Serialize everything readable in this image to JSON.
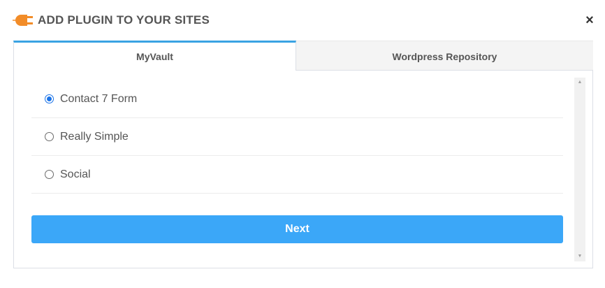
{
  "header": {
    "title": "ADD PLUGIN TO YOUR SITES",
    "close_symbol": "×",
    "icon": "plug-icon",
    "accent_color": "#f28c28"
  },
  "tabs": [
    {
      "label": "MyVault",
      "active": true
    },
    {
      "label": "Wordpress Repository",
      "active": false
    }
  ],
  "options": [
    {
      "label": "Contact 7 Form",
      "selected": true
    },
    {
      "label": "Really Simple",
      "selected": false
    },
    {
      "label": "Social",
      "selected": false
    }
  ],
  "next_button": {
    "label": "Next",
    "color": "#3ba7f8"
  },
  "scrollbar": {
    "up_symbol": "▲",
    "down_symbol": "▼"
  }
}
